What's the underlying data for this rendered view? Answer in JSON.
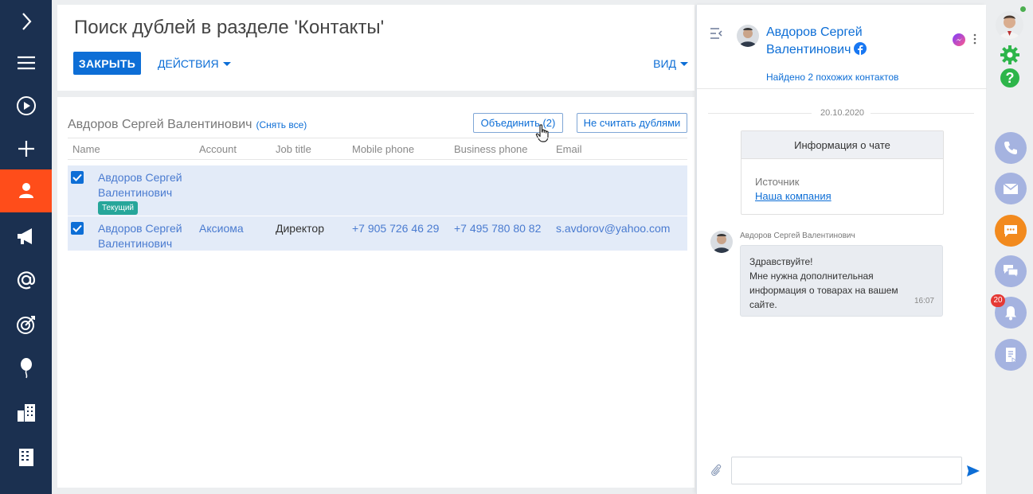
{
  "left_nav": {
    "items": [
      {
        "name": "expand",
        "icon": "chevron-right-icon"
      },
      {
        "name": "menu",
        "icon": "hamburger-icon"
      },
      {
        "name": "processes",
        "icon": "play-icon"
      },
      {
        "name": "add",
        "icon": "plus-icon"
      },
      {
        "name": "contacts",
        "icon": "person-icon",
        "active": true
      },
      {
        "name": "marketing",
        "icon": "megaphone-icon"
      },
      {
        "name": "email",
        "icon": "at-sign-icon"
      },
      {
        "name": "goals",
        "icon": "target-icon"
      },
      {
        "name": "events",
        "icon": "balloon-icon"
      },
      {
        "name": "accounts",
        "icon": "buildings-icon"
      },
      {
        "name": "organization",
        "icon": "building-icon"
      }
    ],
    "active_color": "#ff4d1a",
    "bg_color": "#1b3050"
  },
  "header": {
    "title": "Поиск дублей в разделе 'Контакты'",
    "close_label": "ЗАКРЫТЬ",
    "actions_label": "ДЕЙСТВИЯ",
    "view_label": "ВИД"
  },
  "duplicates": {
    "group_title": "Авдоров Сергей Валентинович",
    "unselect_label": "(Снять все)",
    "merge_label": "Объединить (2)",
    "not_duplicates_label": "Не считать дублями",
    "columns": [
      "Name",
      "Account",
      "Job title",
      "Mobile phone",
      "Business phone",
      "Email"
    ],
    "rows": [
      {
        "checked": true,
        "name": "Авдоров Сергей Валентинович",
        "badge": "Текущий",
        "account": "",
        "job_title": "",
        "mobile": "",
        "business": "",
        "email": ""
      },
      {
        "checked": true,
        "name": "Авдоров Сергей Валентинович",
        "account": "Аксиома",
        "job_title": "Директор",
        "mobile": "+7 905 726 46 29",
        "business": "+7 495 780 80 82",
        "email": "s.avdorov@yahoo.com"
      }
    ]
  },
  "chat": {
    "contact_name": "Авдоров Сергей Валентинович",
    "channel_icon": "facebook-icon",
    "found_label": "Найдено 2 похожих контактов",
    "date": "20.10.2020",
    "info_card": {
      "title": "Информация о чате",
      "source_label": "Источник",
      "source_value": "Наша компания"
    },
    "message": {
      "sender": "Авдоров Сергей Валентинович",
      "text_line1": "Здравствуйте!",
      "text_line2": "Мне нужна дополнительная",
      "text_line3": "информация о товарах на вашем",
      "text_line4": "сайте.",
      "time": "16:07"
    },
    "input_placeholder": ""
  },
  "right_rail": {
    "notification_count": "20",
    "buttons": [
      "phone-icon",
      "mail-icon",
      "chat-icon",
      "messages-icon",
      "bell-icon",
      "document-icon"
    ]
  },
  "colors": {
    "accent": "#0d6ed6",
    "row_selected": "#e3ebf8",
    "badge": "#26a69a",
    "chat_active": "#f28a1e",
    "rail_button": "#a5b3e0"
  }
}
